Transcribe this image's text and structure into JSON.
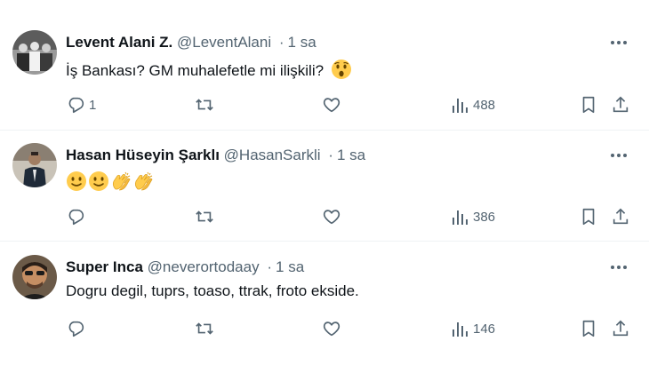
{
  "tweets": [
    {
      "name": "Levent Alani Z.",
      "handle": "@LeventAlani",
      "sep": "·",
      "time": "1 sa",
      "text": "İş Bankası? GM muhalefetle mi ilişkili?",
      "emojis": [
        "astonished-face"
      ],
      "replies": "1",
      "retweets": "",
      "likes": "",
      "views": "488"
    },
    {
      "name": "Hasan Hüseyin Şarklı",
      "handle": "@HasanSarkli",
      "sep": "·",
      "time": "1 sa",
      "text": "",
      "emojis": [
        "slightly-smiling-face",
        "slightly-smiling-face",
        "clapping-hands",
        "clapping-hands"
      ],
      "replies": "",
      "retweets": "",
      "likes": "",
      "views": "386"
    },
    {
      "name": "Super Inca",
      "handle": "@neverortodaay",
      "sep": "·",
      "time": "1 sa",
      "text": "Dogru degil, tuprs, toaso, ttrak, froto ekside.",
      "emojis": [],
      "replies": "",
      "retweets": "",
      "likes": "",
      "views": "146"
    }
  ],
  "colors": {
    "text": "#0f1419",
    "secondary": "#536471",
    "divider": "#eff3f4",
    "emoji_yellow": "#ffcc4d"
  }
}
